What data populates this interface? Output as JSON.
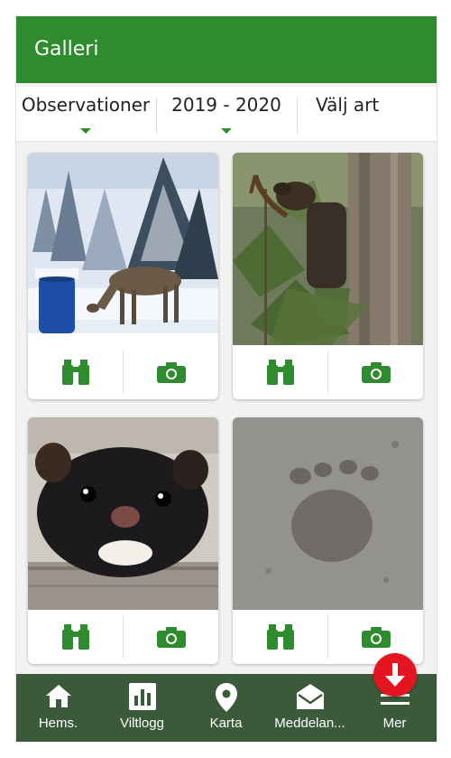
{
  "header": {
    "title": "Galleri"
  },
  "filters": [
    {
      "label": "Observationer",
      "has_dropdown": true
    },
    {
      "label": "2019 - 2020",
      "has_dropdown": true
    },
    {
      "label": "Välj art",
      "has_dropdown": false
    }
  ],
  "gallery": {
    "cards": [
      {
        "photo": "roe-deer-in-snow-feeding",
        "actions": [
          "binoculars-icon",
          "camera-icon"
        ]
      },
      {
        "photo": "moose-in-forest",
        "actions": [
          "binoculars-icon",
          "camera-icon"
        ]
      },
      {
        "photo": "mink-close-up",
        "actions": [
          "binoculars-icon",
          "camera-icon"
        ]
      },
      {
        "photo": "animal-track-in-mud",
        "actions": [
          "binoculars-icon",
          "camera-icon"
        ]
      }
    ]
  },
  "navbar": {
    "items": [
      {
        "label": "Hems.",
        "icon": "home-icon"
      },
      {
        "label": "Viltlogg",
        "icon": "bar-chart-icon"
      },
      {
        "label": "Karta",
        "icon": "map-pin-icon"
      },
      {
        "label": "Meddelan...",
        "icon": "envelope-icon"
      },
      {
        "label": "Mer",
        "icon": "menu-icon"
      }
    ]
  },
  "fab": {
    "icon": "arrow-down-icon"
  },
  "colors": {
    "brand_green": "#2e8b2e",
    "navbar_bg": "#3a5a3a",
    "fab_red": "#e4151f"
  }
}
